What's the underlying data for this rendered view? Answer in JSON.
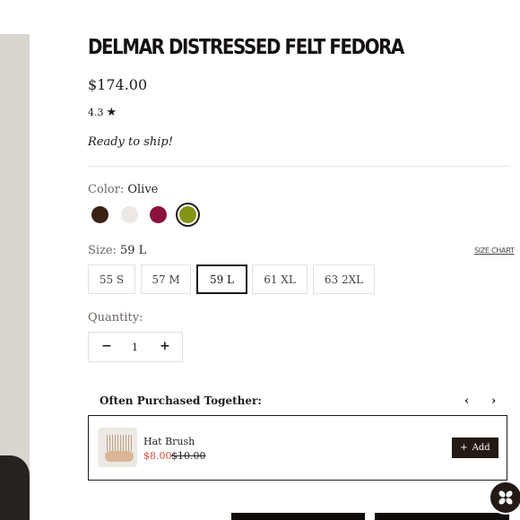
{
  "product": {
    "title": "DELMAR DISTRESSED FELT FEDORA",
    "price": "$174.00",
    "rating": "4.3",
    "availability": "Ready to ship!"
  },
  "color": {
    "label": "Color:",
    "selected": "Olive",
    "swatches": [
      {
        "name": "dark-brown",
        "hex": "#3a2214"
      },
      {
        "name": "cream",
        "hex": "#efe8e2"
      },
      {
        "name": "burgundy",
        "hex": "#8b1240"
      },
      {
        "name": "olive",
        "hex": "#869416",
        "selected": true
      }
    ]
  },
  "size": {
    "label": "Size:",
    "selected": "59 L",
    "chart_link": "SIZE CHART",
    "options": [
      "55 S",
      "57 M",
      "59 L",
      "61 XL",
      "63 2XL"
    ]
  },
  "quantity": {
    "label": "Quantity:",
    "value": "1",
    "minus": "−",
    "plus": "+"
  },
  "upsell": {
    "title": "Often Purchased Together:",
    "prev": "‹",
    "next": "›",
    "item": {
      "name": "Hat Brush",
      "sale_price": "$8.00",
      "original_price": "$10.00",
      "add_label": "Add",
      "add_icon": "+"
    }
  },
  "icons": {
    "star": "★",
    "chat": "chat-logo-icon"
  }
}
